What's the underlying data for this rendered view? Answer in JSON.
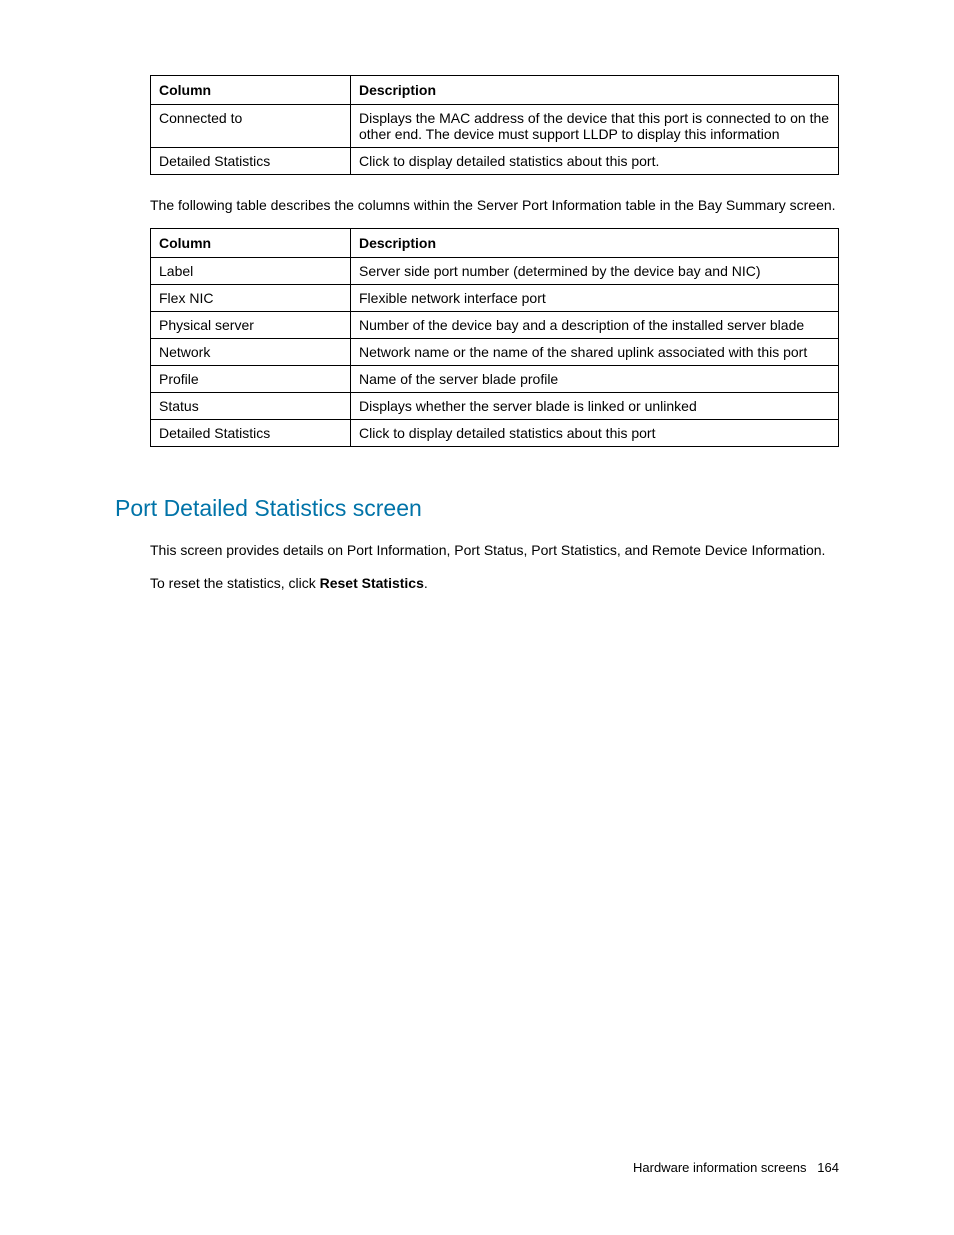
{
  "table1": {
    "headers": {
      "col1": "Column",
      "col2": "Description"
    },
    "rows": [
      {
        "col1": "Connected to",
        "col2": "Displays the MAC address of the device that this port is connected to on the other end. The device must support LLDP to display this information"
      },
      {
        "col1": "Detailed Statistics",
        "col2": "Click to display detailed statistics about this port."
      }
    ]
  },
  "paragraph1": "The following table describes the columns within the Server Port Information table in the Bay Summary screen.",
  "table2": {
    "headers": {
      "col1": "Column",
      "col2": "Description"
    },
    "rows": [
      {
        "col1": "Label",
        "col2": "Server side port number (determined by the device bay and NIC)"
      },
      {
        "col1": "Flex NIC",
        "col2": "Flexible network interface port"
      },
      {
        "col1": "Physical server",
        "col2": "Number of the device bay and a description of the installed server blade"
      },
      {
        "col1": "Network",
        "col2": "Network name or the name of the shared uplink associated with this port"
      },
      {
        "col1": "Profile",
        "col2": "Name of the server blade profile"
      },
      {
        "col1": "Status",
        "col2": "Displays whether the server blade is linked or unlinked"
      },
      {
        "col1": "Detailed Statistics",
        "col2": "Click to display detailed statistics about this port"
      }
    ]
  },
  "section_heading": "Port Detailed Statistics screen",
  "paragraph2": "This screen provides details on Port Information, Port Status, Port Statistics, and Remote Device Information.",
  "reset_prefix": "To reset the statistics, click ",
  "reset_bold": "Reset Statistics",
  "reset_suffix": ".",
  "footer_label": "Hardware information screens",
  "footer_page": "164"
}
